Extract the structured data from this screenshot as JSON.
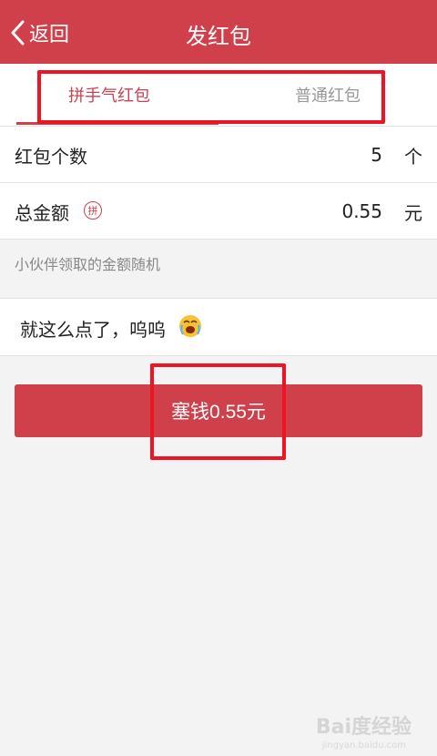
{
  "header": {
    "back_label": "返回",
    "title": "发红包"
  },
  "tabs": [
    {
      "label": "拼手气红包",
      "active": true
    },
    {
      "label": "普通红包",
      "active": false
    }
  ],
  "count_row": {
    "label": "红包个数",
    "value": "5",
    "unit": "个"
  },
  "amount_row": {
    "label": "总金额",
    "badge": "拼",
    "value": "0.55",
    "unit": "元"
  },
  "hint": "小伙伴领取的金额随机",
  "message": {
    "value": "就这么点了，呜呜",
    "emoji": "crying-face-emoji"
  },
  "submit_label": "塞钱0.55元",
  "watermark": {
    "brand": "Bai度经验",
    "url": "jingyan.baidu.com"
  },
  "colors": {
    "primary": "#d0404b",
    "highlight_box": "#ef1424",
    "background": "#f3f3f3"
  }
}
